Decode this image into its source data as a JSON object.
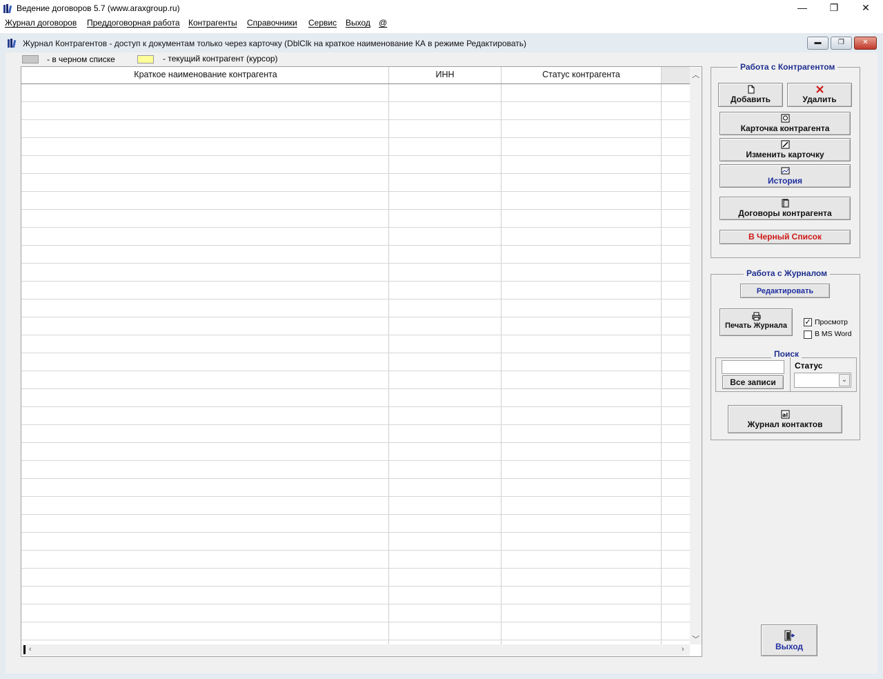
{
  "window": {
    "title": "Ведение договоров 5.7 (www.araxgroup.ru)",
    "minimize": "—",
    "maximize": "❐",
    "close": "✕"
  },
  "menu": [
    "Журнал договоров",
    "Преддоговорная работа",
    "Контрагенты",
    "Справочники",
    "Сервис",
    "Выход",
    "@"
  ],
  "child": {
    "title": "Журнал Контрагентов - доступ к документам только через карточку (DblClk на краткое наименование КА в режиме Редактировать)"
  },
  "legend": {
    "blacklist": "- в черном списке",
    "current": "- текущий контрагент (курсор)",
    "blacklist_color": "#c8c8c8",
    "current_color": "#ffff99"
  },
  "grid": {
    "columns": [
      "Краткое наименование контрагента",
      "ИНН",
      "Статус контрагента"
    ],
    "rows": []
  },
  "counterparty_group": {
    "title": "Работа с Контрагентом",
    "add": "Добавить",
    "delete": "Удалить",
    "card": "Карточка контрагента",
    "edit_card": "Изменить карточку",
    "history": "История",
    "contracts": "Договоры контрагента",
    "blacklist": "В Черный Список"
  },
  "journal_group": {
    "title": "Работа с Журналом",
    "edit": "Редактировать",
    "print": "Печать Журнала",
    "preview_label": "Просмотр",
    "preview_checked": true,
    "msword_label": "В MS Word",
    "msword_checked": false,
    "search_title": "Поиск",
    "search_value": "",
    "all_records": "Все записи",
    "status_label": "Статус",
    "status_value": "",
    "contacts": "Журнал контактов"
  },
  "exit_button": "Выход"
}
